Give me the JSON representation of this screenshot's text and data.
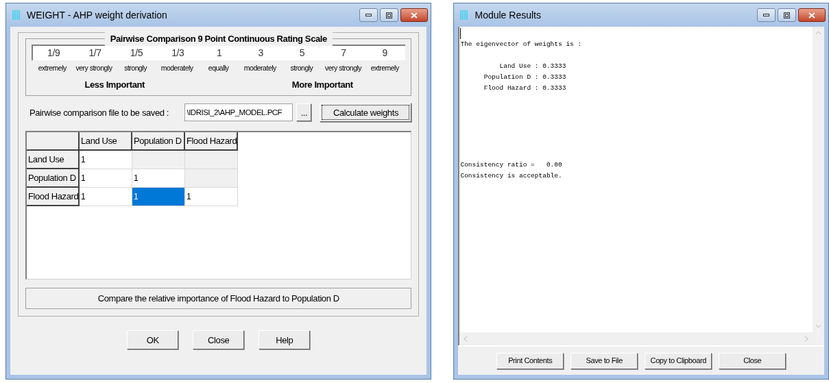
{
  "weight_window": {
    "title": "WEIGHT - AHP weight derivation",
    "scale": {
      "title": "Pairwise Comparison 9 Point Continuous Rating Scale",
      "points": [
        {
          "value": "1/9",
          "label": "extremely"
        },
        {
          "value": "1/7",
          "label": "very strongly"
        },
        {
          "value": "1/5",
          "label": "strongly"
        },
        {
          "value": "1/3",
          "label": "moderately"
        },
        {
          "value": "1",
          "label": "equally"
        },
        {
          "value": "3",
          "label": "moderately"
        },
        {
          "value": "5",
          "label": "strongly"
        },
        {
          "value": "7",
          "label": "very strongly"
        },
        {
          "value": "9",
          "label": "extremely"
        }
      ],
      "less_label": "Less Important",
      "more_label": "More Important"
    },
    "file_label": "Pairwise comparison file to be saved :",
    "file_value": "\\IDRISI_2\\AHP_MODEL.PCF",
    "browse_button": "...",
    "calculate_button": "Calculate weights",
    "grid": {
      "columns": [
        "Land Use",
        "Population D",
        "Flood Hazard"
      ],
      "rows": [
        {
          "header": "Land Use",
          "cells": [
            {
              "value": "1",
              "selected": false,
              "disabled": false
            },
            {
              "selected": false,
              "disabled": true
            },
            {
              "selected": false,
              "disabled": true
            }
          ]
        },
        {
          "header": "Population D",
          "cells": [
            {
              "value": "1",
              "selected": false,
              "disabled": false
            },
            {
              "value": "1",
              "selected": false,
              "disabled": false
            },
            {
              "selected": false,
              "disabled": true
            }
          ]
        },
        {
          "header": "Flood Hazard",
          "cells": [
            {
              "value": "1",
              "selected": false,
              "disabled": false
            },
            {
              "value": "1",
              "selected": true,
              "disabled": false
            },
            {
              "value": "1",
              "selected": false,
              "disabled": false
            }
          ]
        }
      ]
    },
    "prompt": "Compare the relative importance of Flood Hazard to Population D",
    "buttons": [
      "OK",
      "Close",
      "Help"
    ]
  },
  "results_window": {
    "title": "Module Results",
    "header_line": "The eigenvector of weights is :",
    "weight_lines": [
      "          Land Use : 0.3333",
      "      Population D : 0.3333",
      "      Flood Hazard : 0.3333"
    ],
    "ratio_line": "Consistency ratio =   0.00",
    "verdict_line": "Consistency is acceptable.",
    "buttons": [
      "Print Contents",
      "Save to File",
      "Copy to Clipboard",
      "Close"
    ]
  }
}
